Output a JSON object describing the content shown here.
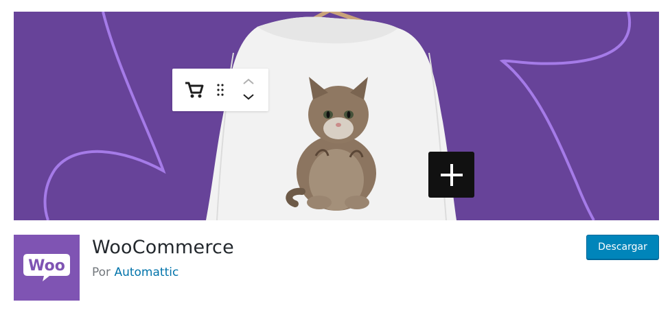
{
  "banner": {
    "background_color": "#674399",
    "accent_color": "#a57be8",
    "toolbar_icons": [
      "cart-icon",
      "drag-handle-icon",
      "chevron-up-icon",
      "chevron-down-icon"
    ],
    "plus_icon": "plus-icon"
  },
  "plugin": {
    "title": "WooCommerce",
    "author_prefix": "Por",
    "author_name": "Automattic",
    "icon_text": "Woo",
    "icon_color": "#7f54b3"
  },
  "actions": {
    "download_label": "Descargar",
    "download_color": "#0085ba"
  }
}
